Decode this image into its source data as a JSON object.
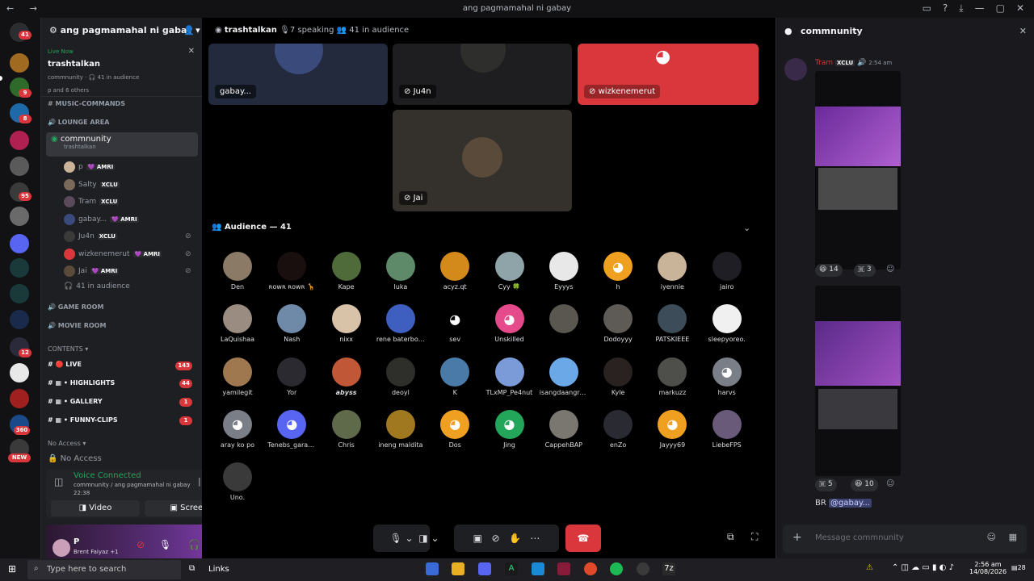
{
  "window": {
    "title": "ang pagmamahal ni gabay"
  },
  "server": {
    "name": "ang pagmamahal ni gabay",
    "home_badge": "41"
  },
  "guild_badges": [
    "9",
    "8",
    "95",
    "12",
    "360",
    "NEW"
  ],
  "live": {
    "status": "Live Now",
    "title": "trashtalkan",
    "sub": "commnunity · 🎧 41 in audience",
    "watchers": "p and 6 others"
  },
  "channels": {
    "music": "MUSIC-COMMANDS",
    "lounge": "LOUNGE AREA",
    "active_name": "commnunity",
    "active_topic": "trashtalkan",
    "members": [
      {
        "name": "p",
        "tag": "💜 AMRI"
      },
      {
        "name": "Salty",
        "tag": "XCLU"
      },
      {
        "name": "Tram",
        "tag": "XCLU"
      },
      {
        "name": "gabay...",
        "tag": "💜 AMRI"
      },
      {
        "name": "Ju4n",
        "tag": "XCLU"
      },
      {
        "name": "wizkenemerut",
        "tag": "💜 AMRI"
      },
      {
        "name": "Jai",
        "tag": "💜 AMRI"
      }
    ],
    "audience_count": "41 in audience",
    "game": "GAME ROOM",
    "movie": "MOVIE ROOM",
    "contents": "CONTENTS",
    "content_items": [
      {
        "name": "LIVE",
        "badge": "143"
      },
      {
        "name": "HIGHLIGHTS",
        "badge": "44"
      },
      {
        "name": "GALLERY",
        "badge": "1"
      },
      {
        "name": "FUNNY-CLIPS",
        "badge": "1"
      }
    ],
    "no_access_cat": "No Access",
    "no_access": "No Access"
  },
  "voice": {
    "status": "Voice Connected",
    "path": "commnunity / ang pagmamahal ni gabay",
    "time": "22:38",
    "video": "Video",
    "screen": "Screen"
  },
  "user": {
    "name": "P",
    "activity": "Brent Faiyaz +1"
  },
  "stage": {
    "channel": "trashtalkan",
    "speaking": "7 speaking",
    "audience": "41 in audience",
    "tiles": [
      {
        "name": "gabay..."
      },
      {
        "name": "Ju4n"
      },
      {
        "name": "wizkenemerut"
      },
      {
        "name": "Jai"
      }
    ]
  },
  "audience": {
    "header": "Audience — 41",
    "people": [
      {
        "name": "Den",
        "color": "#8a7a66"
      },
      {
        "name": "ʀᴏᴡʀ ʀᴏᴡʀ 🦒",
        "color": "#1a0f0f"
      },
      {
        "name": "Kape",
        "color": "#4f6b3a"
      },
      {
        "name": "luka",
        "color": "#5e8a6a"
      },
      {
        "name": "acyz.qt",
        "color": "#d48a1a"
      },
      {
        "name": "Cyy 🍀",
        "color": "#8fa4a8"
      },
      {
        "name": "Eyyys",
        "color": "#e8e8e8"
      },
      {
        "name": "h",
        "color": "#f0a020",
        "discord": true
      },
      {
        "name": "iyennie",
        "color": "#c9b49a"
      },
      {
        "name": "jairo",
        "color": "#1e1e24"
      },
      {
        "name": "LaQuishaa",
        "color": "#9a8c80"
      },
      {
        "name": "Nash",
        "color": "#6f8aa8"
      },
      {
        "name": "nixx",
        "color": "#d8c2a8"
      },
      {
        "name": "rene baterbon...",
        "color": "#3e5fc0"
      },
      {
        "name": "sev",
        "color": "#000000",
        "discord": true
      },
      {
        "name": "Unskilled",
        "color": "#e54a8a",
        "discord": true
      },
      {
        "name": "",
        "color": "#5a5650"
      },
      {
        "name": "Dodoyyy",
        "color": "#5e5a56"
      },
      {
        "name": "PATSKIEEE",
        "color": "#3c4c58"
      },
      {
        "name": "sleepyoreo.",
        "color": "#f0f0f0"
      },
      {
        "name": "yamilegit",
        "color": "#a07850"
      },
      {
        "name": "Yor",
        "color": "#2a2a30"
      },
      {
        "name": "𝙖𝙗𝙮𝙨𝙨",
        "color": "#c05838"
      },
      {
        "name": "deoyl",
        "color": "#2e2e2a"
      },
      {
        "name": "K",
        "color": "#4a7aa8"
      },
      {
        "name": "TLxMP_Pe4nut",
        "color": "#7a9ad8"
      },
      {
        "name": "isangdaangro...",
        "color": "#6aa8e8"
      },
      {
        "name": "Kyle",
        "color": "#2a2220"
      },
      {
        "name": "markuzz",
        "color": "#4e4e4a"
      },
      {
        "name": "harvs",
        "color": "#7a7e86",
        "discord": true
      },
      {
        "name": "aray ko po",
        "color": "#7a7e86",
        "discord": true
      },
      {
        "name": "Tenebs_garapal",
        "color": "#5865f2",
        "discord": true
      },
      {
        "name": "Chris",
        "color": "#5e6a4a"
      },
      {
        "name": "ineng maldita",
        "color": "#a07820"
      },
      {
        "name": "Dos",
        "color": "#f0a020",
        "discord": true
      },
      {
        "name": "Jing",
        "color": "#23a55a",
        "discord": true
      },
      {
        "name": "CappehBAP",
        "color": "#7a7670"
      },
      {
        "name": "enZo",
        "color": "#2a2a32"
      },
      {
        "name": "Jayyy69",
        "color": "#f0a020",
        "discord": true
      },
      {
        "name": "LiebeFPS",
        "color": "#6a5a7a"
      },
      {
        "name": "Uno.",
        "color": "#3a3a3a"
      }
    ]
  },
  "chat": {
    "channel": "commnunity",
    "author": "Tram",
    "author_tag": "XCLU",
    "time": "2:54 am",
    "reactions": [
      {
        "emoji": "😆",
        "count": "14"
      },
      {
        "emoji": "🇼",
        "count": "3"
      },
      {
        "emoji": "🇼",
        "count": "5"
      },
      {
        "emoji": "😆",
        "count": "10"
      }
    ],
    "caption": "BR",
    "mention": "@gabay...",
    "placeholder": "Message commnunity"
  },
  "taskbar": {
    "search": "Type here to search",
    "links": "Links",
    "time": "2:56 am",
    "date": "14/08/2026",
    "notif": "28"
  },
  "colors": {
    "danger": "#da373c",
    "accent": "#5865f2",
    "green": "#23a55a"
  }
}
